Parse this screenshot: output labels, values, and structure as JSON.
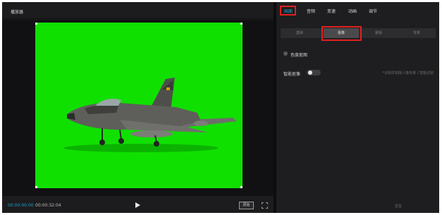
{
  "player": {
    "title": "播放器",
    "time_current": "00:00:00:00",
    "time_total": "00:00:32:04",
    "ratio_label": "原始"
  },
  "properties": {
    "tabs": [
      "画面",
      "音频",
      "变速",
      "动画",
      "调节"
    ],
    "subtabs": [
      "基础",
      "抠像",
      "蒙版",
      "背景"
    ],
    "chroma_key_label": "色度抠图",
    "smart_cutout_label": "智能抠像",
    "smart_cutout_hint": "*识别并扣除人像背景 / 智能识别",
    "reset_label": "重置"
  },
  "icons": {
    "play": "play-icon",
    "fullscreen": "fullscreen-icon"
  },
  "colors": {
    "accent": "#1aa3c9",
    "highlight_box": "#e0211e",
    "green_screen": "#10e000"
  }
}
